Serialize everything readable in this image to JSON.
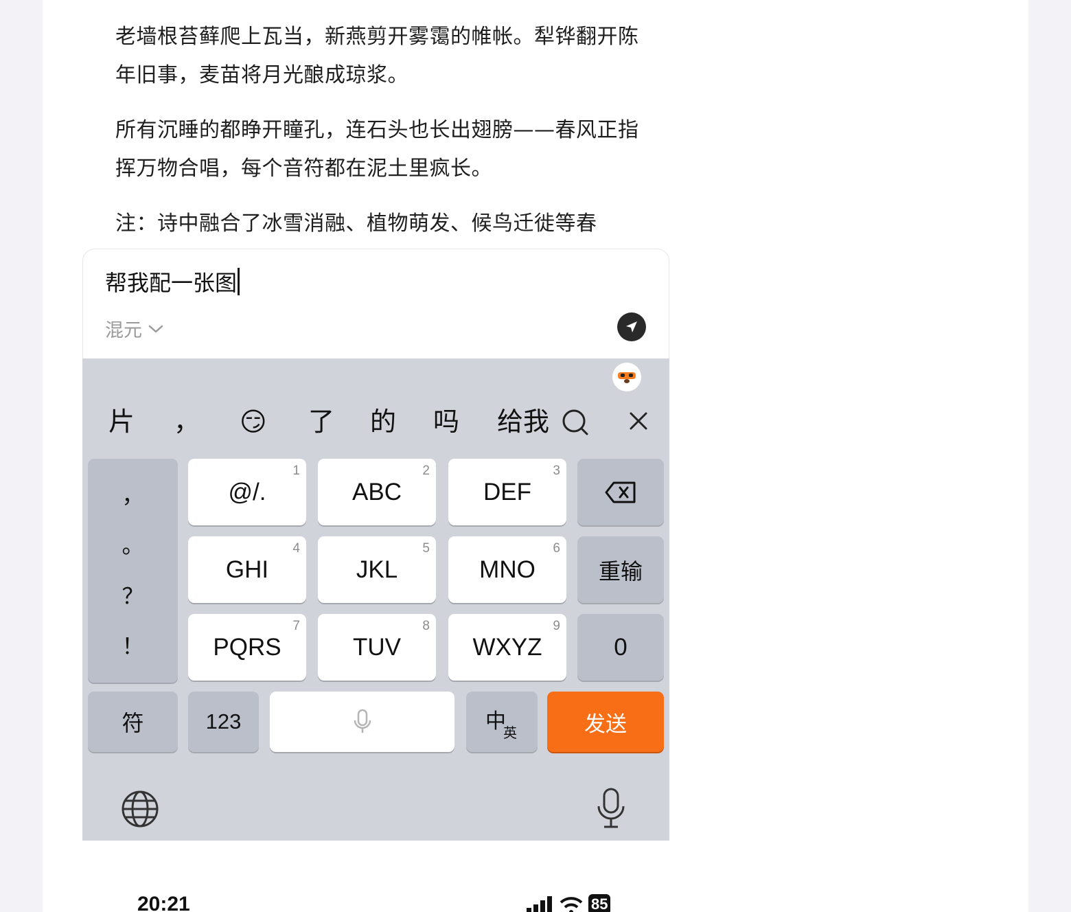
{
  "poem": {
    "lines": [
      "老墙根苔藓爬上瓦当，新燕剪开雾霭的帷帐。犁铧翻开陈年旧事，麦苗将月光酿成琼浆。",
      "所有沉睡的都睁开瞳孔，连石头也长出翅膀——春风正指挥万物合唱，每个音符都在泥土里疯长。",
      "注：诗中融合了冰雪消融、植物萌发、候鸟迁徙等春"
    ]
  },
  "input": {
    "text": "帮我配一张图",
    "model_label": "混元"
  },
  "keyboard": {
    "candidates": [
      "片",
      "，",
      "😏",
      "了",
      "的",
      "吗",
      "给我"
    ],
    "punct_keys": [
      "，",
      "。",
      "？",
      "！"
    ],
    "keys": [
      {
        "label": "@/.",
        "num": "1"
      },
      {
        "label": "ABC",
        "num": "2"
      },
      {
        "label": "DEF",
        "num": "3"
      },
      {
        "label": "GHI",
        "num": "4"
      },
      {
        "label": "JKL",
        "num": "5"
      },
      {
        "label": "MNO",
        "num": "6"
      },
      {
        "label": "PQRS",
        "num": "7"
      },
      {
        "label": "TUV",
        "num": "8"
      },
      {
        "label": "WXYZ",
        "num": "9"
      }
    ],
    "reinput_label": "重输",
    "zero_label": "0",
    "symbol_label": "符",
    "numbers_label": "123",
    "lang_main": "中",
    "lang_sub": "英",
    "send_label": "发送",
    "colors": {
      "send": "#f86e17",
      "keyboard_bg": "#d1d3da"
    }
  },
  "status": {
    "time": "20:21",
    "battery": "85"
  }
}
